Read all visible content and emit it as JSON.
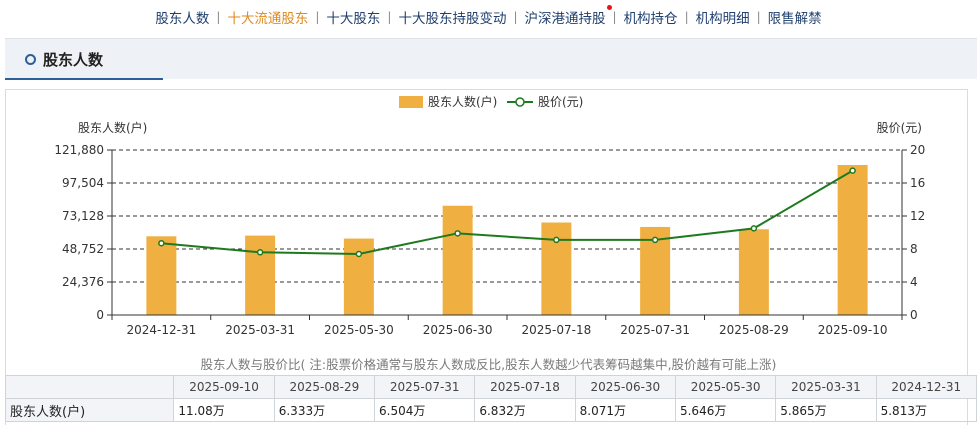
{
  "nav": [
    {
      "label": "股东人数",
      "active": false
    },
    {
      "label": "十大流通股东",
      "active": true
    },
    {
      "label": "十大股东",
      "active": false
    },
    {
      "label": "十大股东持股变动",
      "active": false
    },
    {
      "label": "沪深港通持股",
      "active": false,
      "dot": true
    },
    {
      "label": "机构持仓",
      "active": false
    },
    {
      "label": "机构明细",
      "active": false
    },
    {
      "label": "限售解禁",
      "active": false
    }
  ],
  "section": {
    "title": "股东人数"
  },
  "chart_data": {
    "type": "bar",
    "categories": [
      "2024-12-31",
      "2025-03-31",
      "2025-05-30",
      "2025-06-30",
      "2025-07-18",
      "2025-07-31",
      "2025-08-29",
      "2025-09-10"
    ],
    "series": [
      {
        "name": "股东人数(户)",
        "type": "bar",
        "color": "#f0b041",
        "axis": "left",
        "values": [
          58130,
          58650,
          56460,
          80710,
          68320,
          65040,
          63330,
          110800
        ]
      },
      {
        "name": "股价(元)",
        "type": "line",
        "color": "#1e7a1e",
        "axis": "right",
        "values": [
          8.7,
          7.6,
          7.4,
          9.9,
          9.1,
          9.1,
          10.5,
          17.5
        ]
      }
    ],
    "ylabel_left": "股东人数(户)",
    "ylabel_right": "股价(元)",
    "ylim_left": [
      0,
      121880
    ],
    "ylim_right": [
      0,
      20
    ],
    "yticks_left": [
      "0",
      "24,376",
      "48,752",
      "73,128",
      "97,504",
      "121,880"
    ],
    "yticks_right": [
      "0",
      "4",
      "8",
      "12",
      "16",
      "20"
    ],
    "grid": true,
    "legend": "top-center"
  },
  "note": "股东人数与股价比( 注:股票价格通常与股东人数成反比,股东人数越少代表筹码越集中,股价越有可能上涨)",
  "table": {
    "headers": [
      "2025-09-10",
      "2025-08-29",
      "2025-07-31",
      "2025-07-18",
      "2025-06-30",
      "2025-05-30",
      "2025-03-31",
      "2024-12-31"
    ],
    "row_label": "股东人数(户)",
    "values": [
      "11.08万",
      "6.333万",
      "6.504万",
      "6.832万",
      "8.071万",
      "5.646万",
      "5.865万",
      "5.813万"
    ]
  }
}
